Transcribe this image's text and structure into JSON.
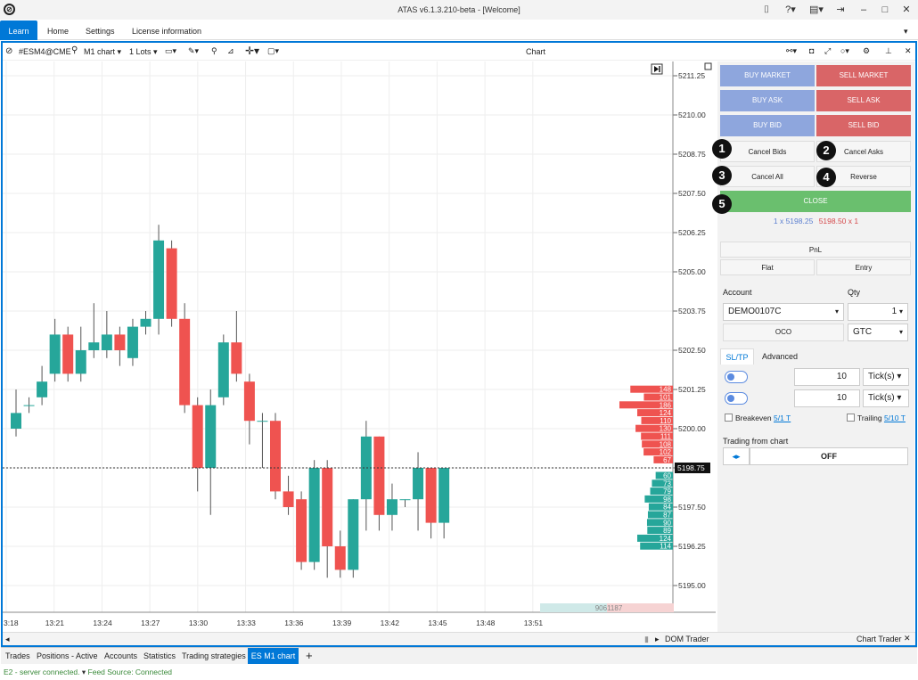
{
  "app": {
    "title": "ATAS v6.1.3.210-beta - [Welcome]"
  },
  "menu": [
    "Learn",
    "Home",
    "Settings",
    "License information"
  ],
  "toolbar": {
    "symbol": "#ESM4@CME",
    "timeframe": "M1 chart",
    "lots": "1 Lots",
    "chart_title": "Chart"
  },
  "chart_data": {
    "type": "candlestick",
    "y_ticks": [
      "5211.25",
      "5210.00",
      "5208.75",
      "5207.50",
      "5206.25",
      "5205.00",
      "5203.75",
      "5202.50",
      "5201.25",
      "5200.00",
      "5198.75",
      "5197.50",
      "5196.25",
      "5195.00"
    ],
    "x_ticks": [
      "3:18",
      "13:21",
      "13:24",
      "13:27",
      "13:30",
      "13:33",
      "13:36",
      "13:39",
      "13:42",
      "13:45",
      "13:48",
      "13:51"
    ],
    "current_price": "5198.75",
    "volume_label": "9061187",
    "candles": [
      {
        "o": 5200.0,
        "c": 5200.5,
        "h": 5201.25,
        "l": 5199.75
      },
      {
        "o": 5200.75,
        "c": 5200.75,
        "h": 5201.0,
        "l": 5200.5
      },
      {
        "o": 5201.0,
        "c": 5201.5,
        "h": 5202.0,
        "l": 5200.75
      },
      {
        "o": 5201.75,
        "c": 5203.0,
        "h": 5203.5,
        "l": 5201.5
      },
      {
        "o": 5203.0,
        "c": 5201.75,
        "h": 5203.25,
        "l": 5201.5
      },
      {
        "o": 5201.75,
        "c": 5202.5,
        "h": 5203.25,
        "l": 5201.5
      },
      {
        "o": 5202.5,
        "c": 5202.75,
        "h": 5204.0,
        "l": 5202.25
      },
      {
        "o": 5202.5,
        "c": 5203.0,
        "h": 5203.75,
        "l": 5202.25
      },
      {
        "o": 5203.0,
        "c": 5202.5,
        "h": 5203.25,
        "l": 5202.0
      },
      {
        "o": 5202.25,
        "c": 5203.25,
        "h": 5203.5,
        "l": 5202.0
      },
      {
        "o": 5203.25,
        "c": 5203.5,
        "h": 5203.75,
        "l": 5203.0
      },
      {
        "o": 5203.5,
        "c": 5206.0,
        "h": 5206.5,
        "l": 5203.0
      },
      {
        "o": 5205.75,
        "c": 5203.5,
        "h": 5206.0,
        "l": 5203.25
      },
      {
        "o": 5203.5,
        "c": 5200.75,
        "h": 5204.0,
        "l": 5200.5
      },
      {
        "o": 5200.75,
        "c": 5198.75,
        "h": 5201.0,
        "l": 5198.0
      },
      {
        "o": 5198.75,
        "c": 5200.75,
        "h": 5201.25,
        "l": 5197.25
      },
      {
        "o": 5201.0,
        "c": 5202.75,
        "h": 5203.0,
        "l": 5200.75
      },
      {
        "o": 5202.75,
        "c": 5201.75,
        "h": 5203.75,
        "l": 5201.5
      },
      {
        "o": 5201.5,
        "c": 5200.25,
        "h": 5201.75,
        "l": 5199.5
      },
      {
        "o": 5200.25,
        "c": 5200.25,
        "h": 5200.5,
        "l": 5198.75
      },
      {
        "o": 5200.25,
        "c": 5198.0,
        "h": 5200.5,
        "l": 5197.75
      },
      {
        "o": 5198.0,
        "c": 5197.5,
        "h": 5198.5,
        "l": 5197.25
      },
      {
        "o": 5197.75,
        "c": 5195.75,
        "h": 5198.0,
        "l": 5195.5
      },
      {
        "o": 5195.75,
        "c": 5198.75,
        "h": 5199.0,
        "l": 5195.5
      },
      {
        "o": 5198.75,
        "c": 5196.25,
        "h": 5199.0,
        "l": 5195.25
      },
      {
        "o": 5196.25,
        "c": 5195.5,
        "h": 5196.75,
        "l": 5195.25
      },
      {
        "o": 5195.5,
        "c": 5197.75,
        "h": 5197.75,
        "l": 5195.25
      },
      {
        "o": 5197.75,
        "c": 5199.75,
        "h": 5200.25,
        "l": 5196.75
      },
      {
        "o": 5199.75,
        "c": 5197.25,
        "h": 5199.75,
        "l": 5196.75
      },
      {
        "o": 5197.25,
        "c": 5197.75,
        "h": 5198.25,
        "l": 5196.75
      },
      {
        "o": 5197.75,
        "c": 5197.75,
        "h": 5197.75,
        "l": 5197.5
      },
      {
        "o": 5197.75,
        "c": 5198.75,
        "h": 5199.25,
        "l": 5196.75
      },
      {
        "o": 5198.75,
        "c": 5197.0,
        "h": 5198.75,
        "l": 5196.5
      },
      {
        "o": 5197.0,
        "c": 5198.75,
        "h": 5198.75,
        "l": 5196.5
      }
    ],
    "ladder": [
      {
        "price": 5201.25,
        "v": 148,
        "side": "ask"
      },
      {
        "price": 5201.0,
        "v": 101,
        "side": "ask"
      },
      {
        "price": 5200.75,
        "v": 186,
        "side": "ask"
      },
      {
        "price": 5200.5,
        "v": 124,
        "side": "ask"
      },
      {
        "price": 5200.25,
        "v": 110,
        "side": "ask"
      },
      {
        "price": 5200.0,
        "v": 130,
        "side": "ask"
      },
      {
        "price": 5199.75,
        "v": 111,
        "side": "ask"
      },
      {
        "price": 5199.5,
        "v": 108,
        "side": "ask"
      },
      {
        "price": 5199.25,
        "v": 102,
        "side": "ask"
      },
      {
        "price": 5199.0,
        "v": 67,
        "side": "ask"
      },
      {
        "price": 5198.5,
        "v": 60,
        "side": "bid"
      },
      {
        "price": 5198.25,
        "v": 73,
        "side": "bid"
      },
      {
        "price": 5198.0,
        "v": 79,
        "side": "bid"
      },
      {
        "price": 5197.75,
        "v": 98,
        "side": "bid"
      },
      {
        "price": 5197.5,
        "v": 84,
        "side": "bid"
      },
      {
        "price": 5197.25,
        "v": 87,
        "side": "bid"
      },
      {
        "price": 5197.0,
        "v": 90,
        "side": "bid"
      },
      {
        "price": 5196.75,
        "v": 89,
        "side": "bid"
      },
      {
        "price": 5196.5,
        "v": 124,
        "side": "bid"
      },
      {
        "price": 5196.25,
        "v": 114,
        "side": "bid"
      }
    ],
    "colors": {
      "up": "#26a69a",
      "down": "#ef5350",
      "ask": "#ef5350",
      "bid": "#26a69a"
    }
  },
  "trading": {
    "buy_market": "BUY MARKET",
    "sell_market": "SELL MARKET",
    "buy_ask": "BUY ASK",
    "sell_ask": "SELL ASK",
    "buy_bid": "BUY BID",
    "sell_bid": "SELL BID",
    "cancel_bids": "Cancel Bids",
    "cancel_asks": "Cancel Asks",
    "cancel_all": "Cancel All",
    "reverse": "Reverse",
    "close": "CLOSE",
    "bid_quote": "1 x 5198.25",
    "ask_quote": "5198.50 x 1",
    "pnl": "PnL",
    "flat": "Flat",
    "entry": "Entry",
    "account_label": "Account",
    "qty_label": "Qty",
    "account": "DEMO0107C",
    "qty": "1",
    "oco": "OCO",
    "tif": "GTC",
    "tab_sltp": "SL/TP",
    "tab_advanced": "Advanced",
    "stop_value": "10",
    "stop_unit": "Tick(s)",
    "take_value": "10",
    "take_unit": "Tick(s)",
    "breakeven": "Breakeven",
    "breakeven_link": "5/1 T",
    "trailing": "Trailing",
    "trailing_link": "5/10 T",
    "from_chart": "Trading from chart",
    "off": "OFF",
    "badges": [
      "1",
      "2",
      "3",
      "4",
      "5"
    ]
  },
  "scroll": {
    "dom_trader": "DOM Trader",
    "chart_trader": "Chart Trader"
  },
  "bottom_tabs": [
    "Trades",
    "Positions - Active",
    "Accounts",
    "Statistics",
    "Trading strategies",
    "ES M1 chart"
  ],
  "status": {
    "server": "E2 - server connected.",
    "feed": "Feed Source: Connected"
  }
}
